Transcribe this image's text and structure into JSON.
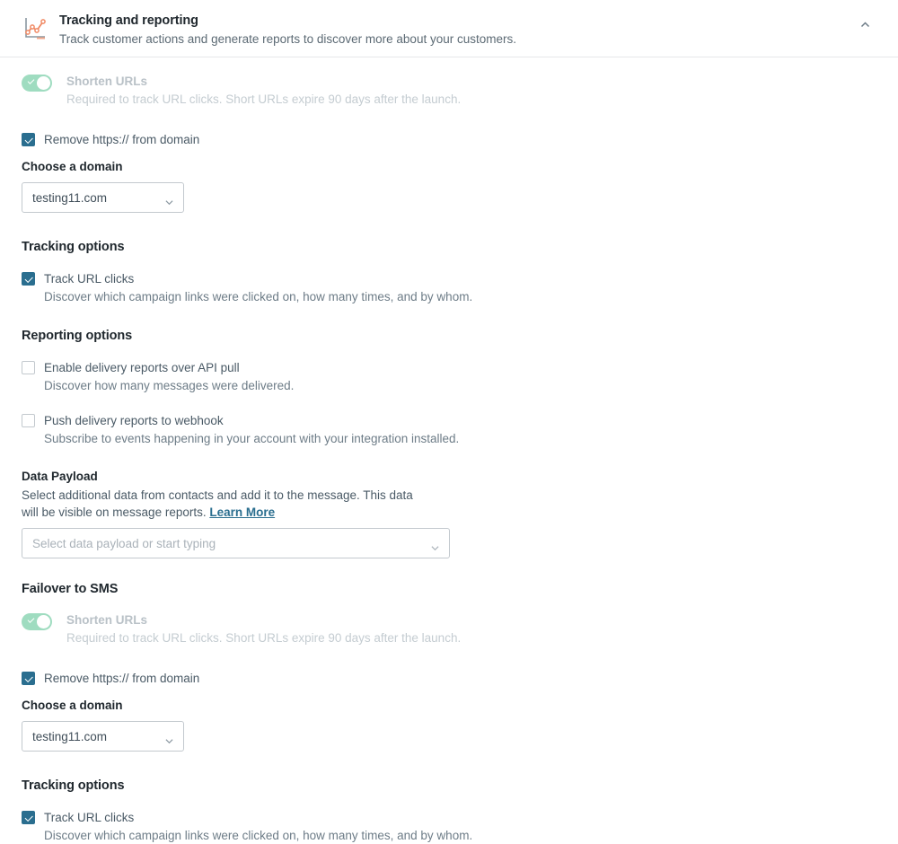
{
  "header": {
    "icon": "line-chart-icon",
    "title": "Tracking and reporting",
    "subtitle": "Track customer actions and generate reports to discover more about your customers.",
    "collapse_icon": "chevron-up-icon"
  },
  "colors": {
    "accent": "#2a6e8f",
    "toggle_on": "#9fdcc0",
    "link": "#2a6e8f",
    "icon_orange": "#f08a65",
    "text_primary": "#20282e",
    "text_muted": "#6d7c87",
    "text_disabled": "#b9c1c7",
    "border": "#c3c9ce"
  },
  "email": {
    "shorten_urls": {
      "label": "Shorten URLs",
      "description": "Required to track URL clicks. Short URLs expire 90 days after the launch.",
      "state": "on",
      "disabled": true
    },
    "remove_https": {
      "label": "Remove https:// from domain",
      "checked": true
    },
    "domain_field": {
      "label": "Choose a domain",
      "value": "testing11.com",
      "caret_icon": "chevron-down-icon"
    },
    "tracking_options": {
      "heading": "Tracking options",
      "track_url_clicks": {
        "label": "Track URL clicks",
        "description": "Discover which campaign links were clicked on, how many times, and by whom.",
        "checked": true
      }
    },
    "reporting_options": {
      "heading": "Reporting options",
      "items": [
        {
          "label": "Enable delivery reports over API pull",
          "description": "Discover how many messages were delivered.",
          "checked": false
        },
        {
          "label": "Push delivery reports to webhook",
          "description": "Subscribe to events happening in your account with your integration installed.",
          "checked": false
        }
      ]
    },
    "data_payload": {
      "label": "Data Payload",
      "description_part1": "Select additional data from contacts and add it to the message. This data will be visible on message reports. ",
      "link_text": "Learn More",
      "placeholder": "Select data payload or start typing",
      "value": "",
      "caret_icon": "chevron-down-icon"
    }
  },
  "failover": {
    "heading": "Failover to SMS",
    "shorten_urls": {
      "label": "Shorten URLs",
      "description": "Required to track URL clicks. Short URLs expire 90 days after the launch.",
      "state": "on",
      "disabled": true
    },
    "remove_https": {
      "label": "Remove https:// from domain",
      "checked": true
    },
    "domain_field": {
      "label": "Choose a domain",
      "value": "testing11.com",
      "caret_icon": "chevron-down-icon"
    },
    "tracking_options": {
      "heading": "Tracking options",
      "track_url_clicks": {
        "label": "Track URL clicks",
        "description": "Discover which campaign links were clicked on, how many times, and by whom.",
        "checked": true
      }
    }
  }
}
